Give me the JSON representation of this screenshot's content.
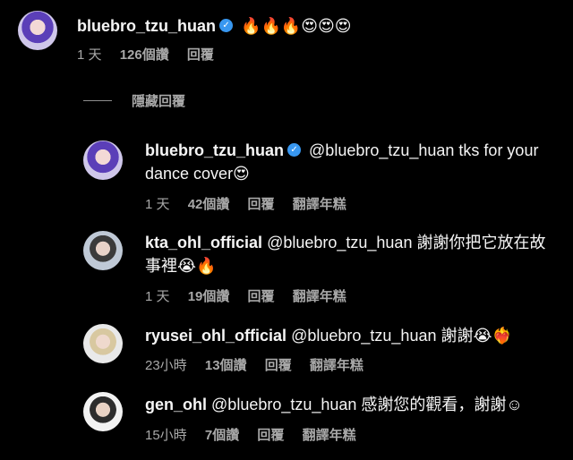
{
  "top_comment": {
    "username": "bluebro_tzu_huan",
    "text": "🔥🔥🔥😍😍😍",
    "time": "1 天",
    "likes": "126個讚",
    "reply": "回覆"
  },
  "hidden_replies_label": "隱藏回覆",
  "replies": [
    {
      "username": "bluebro_tzu_huan",
      "text": "@bluebro_tzu_huan tks for your dance cover😍",
      "time": "1 天",
      "likes": "42個讚",
      "reply": "回覆",
      "translate": "翻譯年糕",
      "verified": true
    },
    {
      "username": "kta_ohl_official",
      "text": "@bluebro_tzu_huan 謝謝你把它放在故事裡😭🔥",
      "time": "1 天",
      "likes": "19個讚",
      "reply": "回覆",
      "translate": "翻譯年糕",
      "verified": false
    },
    {
      "username": "ryusei_ohl_official",
      "text": "@bluebro_tzu_huan 謝謝😭❤️‍🔥",
      "time": "23小時",
      "likes": "13個讚",
      "reply": "回覆",
      "translate": "翻譯年糕",
      "verified": false
    },
    {
      "username": "gen_ohl",
      "text": "@bluebro_tzu_huan 感謝您的觀看，謝謝☺",
      "time": "15小時",
      "likes": "7個讚",
      "reply": "回覆",
      "translate": "翻譯年糕",
      "verified": false
    }
  ],
  "verified_icon": "verified-badge-icon",
  "colors": {
    "background": "#000000",
    "text": "#f5f5f5",
    "meta": "#a8a8a8",
    "verified": "#3897f0"
  }
}
